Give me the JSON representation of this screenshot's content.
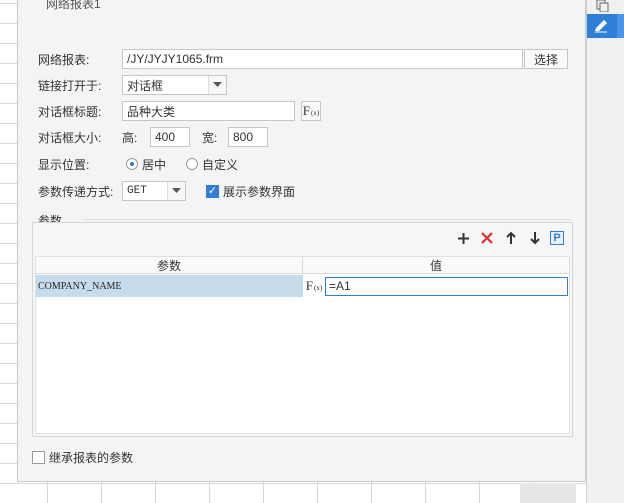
{
  "dialog": {
    "title": "网络报表1"
  },
  "form": {
    "report_label": "网络报表:",
    "report_path": "/JY/JYJY1065.frm",
    "choose_button": "选择",
    "open_in_label": "链接打开于:",
    "open_in_value": "对话框",
    "dialog_title_label": "对话框标题:",
    "dialog_title_value": "品种大类",
    "dialog_size_label": "对话框大小:",
    "height_label": "高:",
    "height_value": "400",
    "width_label": "宽:",
    "width_value": "800",
    "position_label": "显示位置:",
    "position_center": "居中",
    "position_custom": "自定义",
    "method_label": "参数传递方式:",
    "method_value": "GET",
    "show_params_label": "展示参数界面"
  },
  "params": {
    "group_label": "参数",
    "columns": [
      "参数",
      "值"
    ],
    "rows": [
      {
        "name": "COMPANY_NAME",
        "value": "=A1"
      }
    ]
  },
  "inherit": {
    "label": "继承报表的参数"
  },
  "colors": {
    "accent": "#2f7fd8",
    "selected_row": "#c6dbeb",
    "delete_red": "#e0302b"
  }
}
